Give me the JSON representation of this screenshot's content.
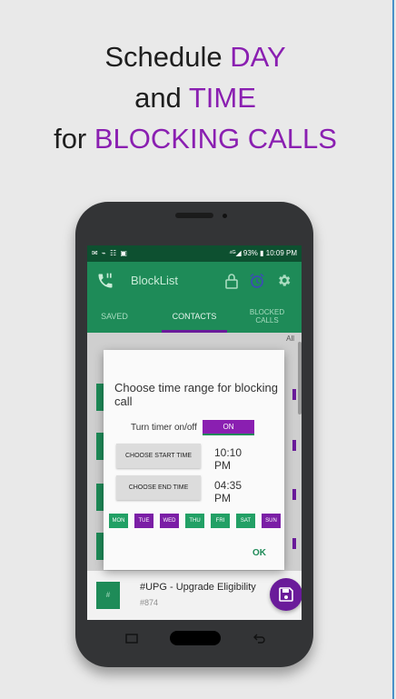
{
  "headline": {
    "line1_plain": "Schedule ",
    "line1_accent": "DAY",
    "line2_plain": "and ",
    "line2_accent": "TIME",
    "line3_plain": "for ",
    "line3_accent": "BLOCKING CALLS"
  },
  "status_bar": {
    "left_icons": "✉ ⌁ ☷ ▣",
    "right": "⁴ᴳ◢ 93% ▮ 10:09 PM"
  },
  "app_bar": {
    "title": "BlockList"
  },
  "tabs": [
    {
      "label": "SAVED"
    },
    {
      "label": "CONTACTS"
    },
    {
      "label": "BLOCKED CALLS"
    }
  ],
  "list": {
    "filter_label": "All",
    "last_row": {
      "title": "#UPG - Upgrade Eligibility",
      "subtitle": "#874",
      "icon_text": "#"
    }
  },
  "dialog": {
    "title": "Choose time range for blocking call",
    "timer_label": "Turn timer on/off",
    "timer_state": "ON",
    "start_button": "CHOOSE START TIME",
    "start_time": "10:10 PM",
    "end_button": "CHOOSE END TIME",
    "end_time": "04:35 PM",
    "days": [
      {
        "label": "MON",
        "selected": false
      },
      {
        "label": "TUE",
        "selected": true
      },
      {
        "label": "WED",
        "selected": true
      },
      {
        "label": "THU",
        "selected": false
      },
      {
        "label": "FRI",
        "selected": false
      },
      {
        "label": "SAT",
        "selected": false
      },
      {
        "label": "SUN",
        "selected": true
      }
    ],
    "ok_label": "OK"
  },
  "colors": {
    "brand_green": "#1e8b58",
    "accent_purple": "#8a1fb1",
    "status_green": "#0d5030"
  },
  "icons": [
    "phone-icon",
    "lock-icon",
    "alarm-icon",
    "gear-icon",
    "save-icon",
    "recent-apps-icon",
    "back-icon"
  ]
}
